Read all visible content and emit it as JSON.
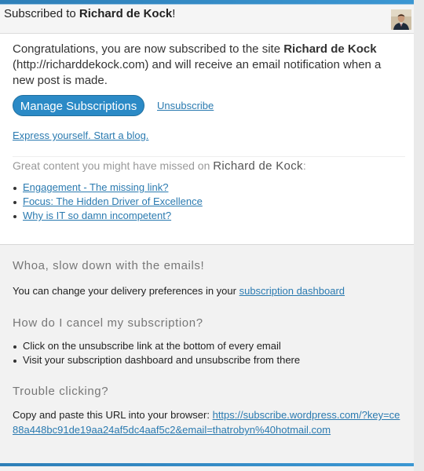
{
  "header": {
    "prefix": "Subscribed to ",
    "site_name": "Richard de Kock",
    "suffix": "!"
  },
  "message": {
    "part1": "Congratulations, you are now subscribed to the site ",
    "site_name": "Richard de Kock",
    "part2": " (http://richarddekock.com) and will receive an email notification when a new post is made."
  },
  "actions": {
    "manage_label": "Manage Subscriptions",
    "unsubscribe_label": "Unsubscribe",
    "express_label": "Express yourself. Start a blog."
  },
  "missed": {
    "prefix": "Great content you might have missed on ",
    "site_name": "Richard de Kock",
    "suffix": ":"
  },
  "posts": [
    {
      "title": "Engagement - The missing link?"
    },
    {
      "title": "Focus: The Hidden Driver of Excellence"
    },
    {
      "title": "Why is IT so damn incompetent?"
    }
  ],
  "slow_down": {
    "heading": "Whoa, slow down with the emails!",
    "text": "You can change your delivery preferences in your ",
    "link": "subscription dashboard"
  },
  "cancel": {
    "heading": "How do I cancel my subscription?",
    "items": [
      "Click on the unsubscribe link at the bottom of every email",
      "Visit your subscription dashboard and unsubscribe from there"
    ]
  },
  "trouble": {
    "heading": "Trouble clicking?",
    "text": "Copy and paste this URL into your browser: ",
    "url": "https://subscribe.wordpress.com/?key=ce88a448bc91de19aa24af5dc4aaf5c2&email=thatrobyn%40hotmail.com"
  },
  "colors": {
    "accent": "#2b8ac6",
    "link": "#2a7ab0"
  }
}
